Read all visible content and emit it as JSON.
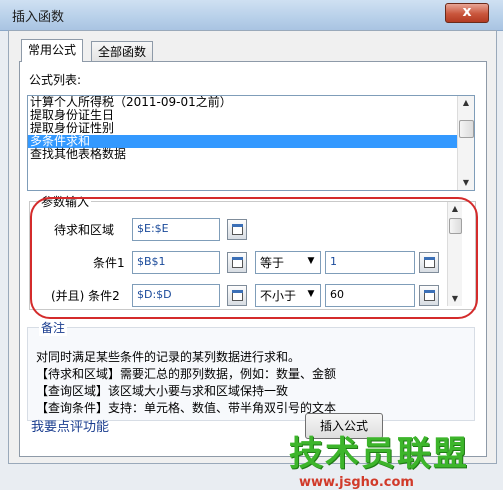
{
  "window": {
    "title": "插入函数",
    "close": "x"
  },
  "tabs": [
    "常用公式",
    "全部函数"
  ],
  "formula_list": {
    "label": "公式列表:",
    "items": [
      "计算个人所得税（2011-09-01之前）",
      "提取身份证生日",
      "提取身份证性别",
      "多条件求和",
      "查找其他表格数据"
    ],
    "selected_index": 3
  },
  "params": {
    "legend": "参数输入",
    "rows": [
      {
        "label": "待求和区域",
        "value": "$E:$E"
      },
      {
        "label": "条件1",
        "value": "$B$1",
        "operator": "等于",
        "operand": "1"
      },
      {
        "label": "(并且) 条件2",
        "value": "$D:$D",
        "operator": "不小于",
        "operand": "60"
      }
    ]
  },
  "notes": {
    "legend": "备注",
    "lines": [
      "对同时满足某些条件的记录的某列数据进行求和。",
      "【待求和区域】需要汇总的那列数据，例如：数量、金额",
      "【查询区域】该区域大小要与求和区域保持一致",
      "【查询条件】支持：单元格、数值、带半角双引号的文本"
    ]
  },
  "footer": {
    "link": "我要点评功能",
    "insert_button": "插入公式"
  },
  "watermark": {
    "text": "技术员联盟",
    "url": "www.jsgho.com"
  }
}
